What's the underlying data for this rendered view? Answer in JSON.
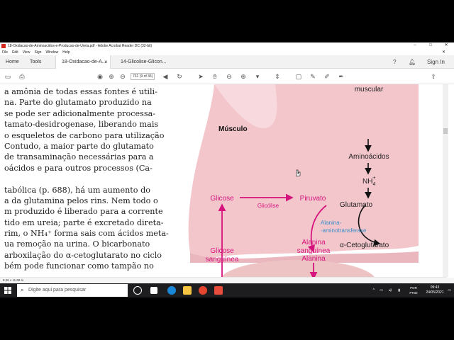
{
  "window": {
    "title": "18-Oxidacao-de-Aminoacidos-e-Producao-de-Ureia.pdf - Adobe Acrobat Reader DC (32-bit)",
    "minimize": "–",
    "maximize": "□",
    "close": "✕"
  },
  "menu": [
    "File",
    "Edit",
    "View",
    "Sign",
    "Window",
    "Help"
  ],
  "tabs": {
    "home": "Home",
    "tools": "Tools",
    "doc1": "18-Oxidacao-de-A...",
    "doc1_close": "×",
    "doc2": "14-Glicolise-Glicon..."
  },
  "header_right": {
    "signin": "Sign In"
  },
  "toolbar": {
    "page_field": "731",
    "page_count": "(9 of 36)"
  },
  "document": {
    "lines": [
      "a amônia de todas essas fontes é utili-",
      "na. Parte do glutamato produzido na",
      "se pode ser adicionalmente processa-",
      "tamato-desidrogenase, liberando mais",
      "o esqueletos de carbono para utilização",
      "Contudo, a maior parte do glutamato",
      "de transaminação necessárias para a",
      "oácidos e para outros processos (Ca-",
      "",
      "tabólica (p. 688), há um aumento do",
      "a da glutamina pelos rins. Nem todo o",
      "m produzido é liberado para a corrente",
      "tido em ureia; parte é excretado direta-",
      "rim, o NH₄⁺ forma sais com ácidos meta-",
      "ua remoção na urina. O bicarbonato",
      "arboxilação do α-cetoglutarato no ciclo",
      "bém pode funcionar como tampão no"
    ],
    "figure": {
      "muscular": "muscular",
      "aminoacidos": "Aminoácidos",
      "nh4": "NH",
      "nh4_sub": "4",
      "nh4_sup": "+",
      "musculo": "Músculo",
      "glicose": "Glicose",
      "glicolise": "Glicólise",
      "piruvato": "Piruvato",
      "glutamato": "Glutamato",
      "enzima_1": "Alanina-",
      "enzima_2": "-aminotransferase",
      "cetoglutarato": "α-Cetoglutarato",
      "alanina": "Alanina",
      "alanina_sanguinea_1": "Alanina",
      "alanina_sanguinea_2": "sanguínea",
      "glicose_sanguinea_1": "Glicose",
      "glicose_sanguinea_2": "sanguínea"
    },
    "colors": {
      "magenta": "#d6147d",
      "blue": "#3b8ec6",
      "muscle": "#f3c6cc"
    }
  },
  "status": {
    "page_size": "8,26 x 11,69 in"
  },
  "taskbar": {
    "search_placeholder": "Digite aqui para pesquisar",
    "lang_1": "POR",
    "lang_2": "PTB2",
    "time": "09:43",
    "date": "24/05/2021"
  }
}
